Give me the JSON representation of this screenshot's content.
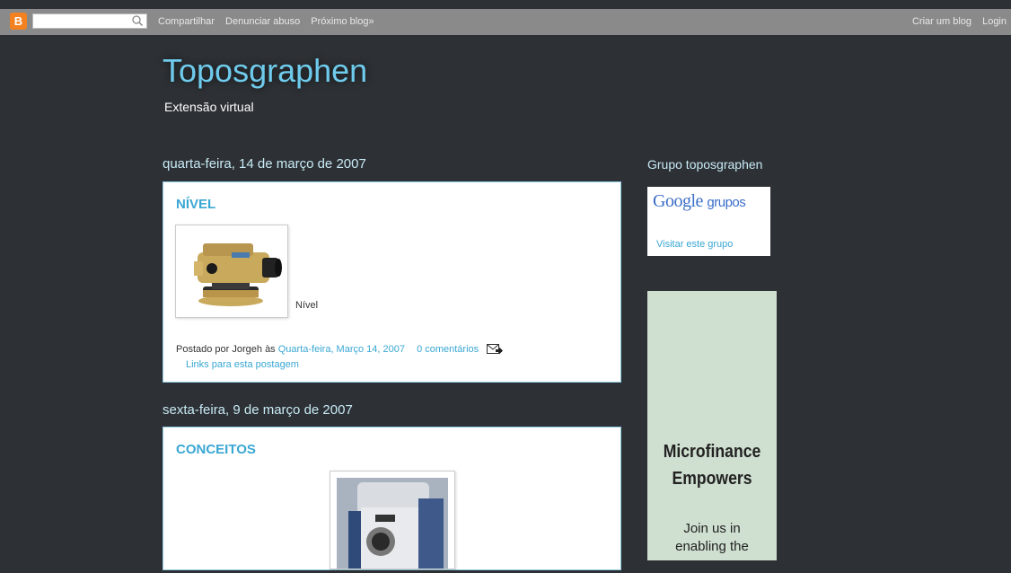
{
  "navbar": {
    "logo_letter": "B",
    "search": {
      "value": "",
      "placeholder": ""
    },
    "links": [
      "Compartilhar",
      "Denunciar abuso",
      "Próximo blog»"
    ],
    "right_links": [
      "Criar um blog",
      "Login"
    ]
  },
  "header": {
    "title": "Toposgraphen",
    "description": "Extensão virtual"
  },
  "posts": [
    {
      "date": "quarta-feira, 14 de março de 2007",
      "title": "NÍVEL",
      "caption": "Nível",
      "footer_prefix": "Postado por Jorgeh às",
      "footer_date_link": "Quarta-feira, Março 14, 2007",
      "comments_link": "0 comentários",
      "backlinks": "Links para esta postagem"
    },
    {
      "date": "sexta-feira, 9 de março de 2007",
      "title": "CONCEITOS"
    }
  ],
  "sidebar": {
    "group_title": "Grupo toposgraphen",
    "google_logo": "Google",
    "google_groups": "grupos",
    "visit_link": "Visitar este grupo",
    "ad_headline_1": "Microfinance",
    "ad_headline_2": "Empowers",
    "ad_body_1": "Join us in",
    "ad_body_2": "enabling the"
  },
  "colors": {
    "background": "#2d3034",
    "title": "#6fcbec",
    "link": "#3aa7d3",
    "ad_background": "#cfdfd0"
  }
}
